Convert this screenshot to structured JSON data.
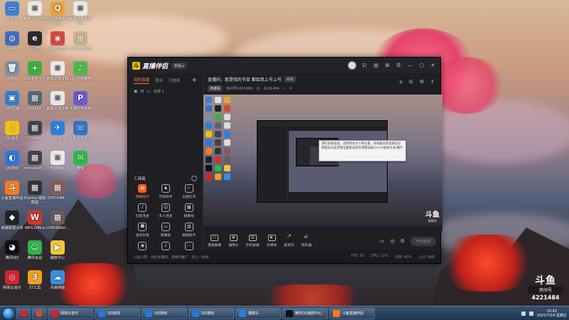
{
  "desktop_icons": [
    {
      "label": "计算机",
      "color": "#3f7fd1",
      "glyph": "▭"
    },
    {
      "label": "新建文本文档",
      "color": "#e8e8e8",
      "glyph": "≡"
    },
    {
      "label": "5QQ游戏大厅 (2)",
      "color": "#e9a23b",
      "glyph": "Q"
    },
    {
      "label": "新建文本文档 (2)",
      "color": "#e8e8e8",
      "glyph": "≡"
    },
    {
      "label": "网络",
      "color": "#3a6fc4",
      "glyph": "◍"
    },
    {
      "label": "e大开",
      "color": "#2a2a2a",
      "glyph": "e"
    },
    {
      "label": "谷歌浏览器",
      "color": "#d9463a",
      "glyph": "◉"
    },
    {
      "label": "1564023b62",
      "color": "#c9b48a",
      "glyph": "▦"
    },
    {
      "label": "回收站",
      "color": "#7a8fa8",
      "glyph": "🗑"
    },
    {
      "label": "360安全卫士",
      "color": "#3dae3d",
      "glyph": "+"
    },
    {
      "label": "新建文本文档",
      "color": "#e8e8e8",
      "glyph": "≡"
    },
    {
      "label": "110平和精英",
      "color": "#4fb84a",
      "glyph": "♪"
    },
    {
      "label": "360压缩",
      "color": "#2d7fd3",
      "glyph": "▣"
    },
    {
      "label": "1052182...",
      "color": "#556677",
      "glyph": "▦"
    },
    {
      "label": "新建文本文档",
      "color": "#e8e8e8",
      "glyph": "≡"
    },
    {
      "label": "无限PDF转换",
      "color": "#6b5bd6",
      "glyph": "P"
    },
    {
      "label": "QQ音乐",
      "color": "#f5c200",
      "glyph": "♫"
    },
    {
      "label": "1371448...",
      "color": "#3d4450",
      "glyph": "▦"
    },
    {
      "label": "迅雷",
      "color": "#2a7fe0",
      "glyph": "✈"
    },
    {
      "label": "手机投屏助手",
      "color": "#2e74c9",
      "glyph": "☏"
    },
    {
      "label": "QQ游戏",
      "color": "#2b77d9",
      "glyph": "◐"
    },
    {
      "label": "mmexport...",
      "color": "#444",
      "glyph": "▦"
    },
    {
      "label": "剪映新版",
      "color": "#e8e8e8",
      "glyph": "≡"
    },
    {
      "label": "微信",
      "color": "#2db84a",
      "glyph": "✉"
    },
    {
      "label": "斗鱼直播伴侣",
      "color": "#ff7a1a",
      "glyph": "斗"
    },
    {
      "label": "Ecortes 模板截图",
      "color": "#333",
      "glyph": "▦"
    },
    {
      "label": "07FCD4B...",
      "color": "#8a5a5a",
      "glyph": "▦"
    },
    {
      "label": "",
      "color": "transparent",
      "glyph": ""
    },
    {
      "label": "英雄联盟大师",
      "color": "#222",
      "glyph": "◆"
    },
    {
      "label": "WPS Office",
      "color": "#d2342d",
      "glyph": "W"
    },
    {
      "label": "C0B598AD...",
      "color": "#6a5a5a",
      "glyph": "▦"
    },
    {
      "label": "",
      "color": "transparent",
      "glyph": ""
    },
    {
      "label": "腾讯QQ",
      "color": "#111",
      "glyph": "◕"
    },
    {
      "label": "腾讯会议",
      "color": "#2db84a",
      "glyph": "☺"
    },
    {
      "label": "播放中心",
      "color": "#f3c63a",
      "glyph": "▶"
    },
    {
      "label": "",
      "color": "transparent",
      "glyph": ""
    },
    {
      "label": "网易云音乐",
      "color": "#d8212a",
      "glyph": "◎"
    },
    {
      "label": "37工具",
      "color": "#f0a020",
      "glyph": "3"
    },
    {
      "label": "百度网盘",
      "color": "#3a8fe0",
      "glyph": "☁"
    },
    {
      "label": "",
      "color": "transparent",
      "glyph": ""
    }
  ],
  "app": {
    "logo_text": "直播伴侣",
    "logo_mark": "斗",
    "version_badge": "新版 ▸",
    "title_icons": [
      "⊡",
      "▤",
      "⊞",
      "☰",
      "—",
      "▢",
      "✕"
    ],
    "left_tabs": [
      {
        "label": "我的直播",
        "active": true
      },
      {
        "label": "观众",
        "active": false
      },
      {
        "label": "可信来",
        "active": false
      }
    ],
    "scene_label": "全屏 1",
    "tools_title": "工具箱",
    "tools": [
      {
        "label": "弹幕助手",
        "glyph": "▤",
        "active": true
      },
      {
        "label": "房管助手",
        "glyph": "♟",
        "active": false
      },
      {
        "label": "主播任务",
        "glyph": "✓",
        "active": false
      },
      {
        "label": "玩家连麦",
        "glyph": "♪",
        "active": false
      },
      {
        "label": "多人连麦",
        "glyph": "☺",
        "active": false
      },
      {
        "label": "跳舞毯",
        "glyph": "▦",
        "active": false
      },
      {
        "label": "虚拟形象",
        "glyph": "☻",
        "active": false
      },
      {
        "label": "弹幕板",
        "glyph": "▭",
        "active": false
      },
      {
        "label": "数据助手",
        "glyph": "▥",
        "active": false
      },
      {
        "label": "录屏",
        "glyph": "◉",
        "active": false
      },
      {
        "label": "下载",
        "glyph": "⇩",
        "active": false
      },
      {
        "label": "更多",
        "glyph": "⋯",
        "active": false
      }
    ],
    "room_title": "直播间，那是我的节目 都给我上号上号",
    "edit_badge": "修改",
    "room_meta": {
      "category": "英雄联",
      "room_id": "房间号4221484",
      "views": "4221484",
      "likes": "0"
    },
    "head_icons": [
      "⌂",
      "⊟",
      "⚙",
      "⇪"
    ],
    "tooltip_text": "请在投屏画面，选择移动大小和位置，再根据对照准备在右侧鼠标点击所需位置拖动即可调整画面Ctrl+V粘贴文本/图片",
    "preview_watermark": "斗鱼",
    "preview_watermark_sub": "房间号",
    "actions": [
      {
        "label": "直播屏幕",
        "glyph": "▭"
      },
      {
        "label": "摄像头",
        "glyph": "◉"
      },
      {
        "label": "手机投屏",
        "glyph": "▤"
      },
      {
        "label": "多媒体",
        "glyph": "▶"
      },
      {
        "label": "麦克风",
        "glyph": "🎤"
      },
      {
        "label": "扬声器",
        "glyph": "🔊"
      }
    ],
    "action_right_icons": [
      "▭",
      "◎",
      "⚙"
    ],
    "start_button": "开始直播",
    "status": {
      "left": "斗鱼公告：你在此期间，直播间推广 · 营上一段将",
      "right": [
        "FPS: 30",
        "CPU: 12%",
        "内存: 40%",
        "上行: 0KB"
      ]
    }
  },
  "douyu_badge": {
    "logo": "斗鱼",
    "sub": "房间号",
    "number": "4221484"
  },
  "taskbar": {
    "pinned": [
      {
        "color": "#d8212a"
      },
      {
        "color": "#d9463a"
      }
    ],
    "items": [
      {
        "label": "网易云音乐",
        "color": "#d8212a"
      },
      {
        "label": "QQ游戏",
        "color": "#2b77d9"
      },
      {
        "label": "QQ游戏",
        "color": "#2b77d9"
      },
      {
        "label": "QQ游戏",
        "color": "#2b77d9"
      },
      {
        "label": "摄像头",
        "color": "#2d7fd3"
      },
      {
        "label": "腾讯QQ播放中心",
        "color": "#111"
      },
      {
        "label": "斗鱼直播伴侣",
        "color": "#ff7a1a"
      }
    ],
    "clock_time": "15:42",
    "clock_date": "2021/7/16 星期五"
  }
}
